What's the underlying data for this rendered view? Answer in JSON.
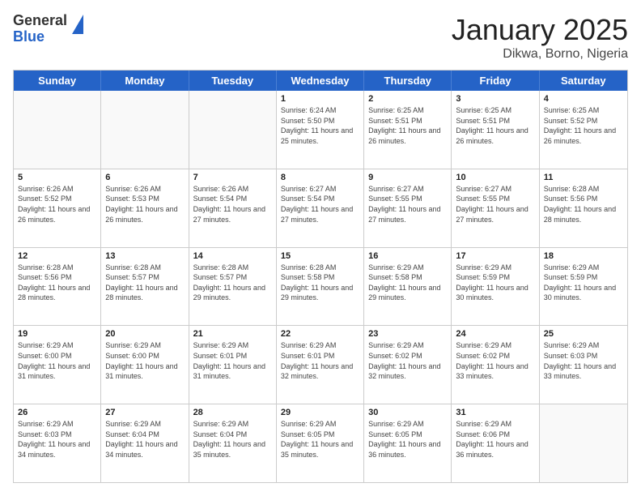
{
  "logo": {
    "general": "General",
    "blue": "Blue"
  },
  "header": {
    "month": "January 2025",
    "location": "Dikwa, Borno, Nigeria"
  },
  "days": {
    "headers": [
      "Sunday",
      "Monday",
      "Tuesday",
      "Wednesday",
      "Thursday",
      "Friday",
      "Saturday"
    ]
  },
  "weeks": [
    [
      {
        "num": "",
        "sunrise": "",
        "sunset": "",
        "daylight": "",
        "empty": true
      },
      {
        "num": "",
        "sunrise": "",
        "sunset": "",
        "daylight": "",
        "empty": true
      },
      {
        "num": "",
        "sunrise": "",
        "sunset": "",
        "daylight": "",
        "empty": true
      },
      {
        "num": "1",
        "sunrise": "Sunrise: 6:24 AM",
        "sunset": "Sunset: 5:50 PM",
        "daylight": "Daylight: 11 hours and 25 minutes.",
        "empty": false
      },
      {
        "num": "2",
        "sunrise": "Sunrise: 6:25 AM",
        "sunset": "Sunset: 5:51 PM",
        "daylight": "Daylight: 11 hours and 26 minutes.",
        "empty": false
      },
      {
        "num": "3",
        "sunrise": "Sunrise: 6:25 AM",
        "sunset": "Sunset: 5:51 PM",
        "daylight": "Daylight: 11 hours and 26 minutes.",
        "empty": false
      },
      {
        "num": "4",
        "sunrise": "Sunrise: 6:25 AM",
        "sunset": "Sunset: 5:52 PM",
        "daylight": "Daylight: 11 hours and 26 minutes.",
        "empty": false
      }
    ],
    [
      {
        "num": "5",
        "sunrise": "Sunrise: 6:26 AM",
        "sunset": "Sunset: 5:52 PM",
        "daylight": "Daylight: 11 hours and 26 minutes.",
        "empty": false
      },
      {
        "num": "6",
        "sunrise": "Sunrise: 6:26 AM",
        "sunset": "Sunset: 5:53 PM",
        "daylight": "Daylight: 11 hours and 26 minutes.",
        "empty": false
      },
      {
        "num": "7",
        "sunrise": "Sunrise: 6:26 AM",
        "sunset": "Sunset: 5:54 PM",
        "daylight": "Daylight: 11 hours and 27 minutes.",
        "empty": false
      },
      {
        "num": "8",
        "sunrise": "Sunrise: 6:27 AM",
        "sunset": "Sunset: 5:54 PM",
        "daylight": "Daylight: 11 hours and 27 minutes.",
        "empty": false
      },
      {
        "num": "9",
        "sunrise": "Sunrise: 6:27 AM",
        "sunset": "Sunset: 5:55 PM",
        "daylight": "Daylight: 11 hours and 27 minutes.",
        "empty": false
      },
      {
        "num": "10",
        "sunrise": "Sunrise: 6:27 AM",
        "sunset": "Sunset: 5:55 PM",
        "daylight": "Daylight: 11 hours and 27 minutes.",
        "empty": false
      },
      {
        "num": "11",
        "sunrise": "Sunrise: 6:28 AM",
        "sunset": "Sunset: 5:56 PM",
        "daylight": "Daylight: 11 hours and 28 minutes.",
        "empty": false
      }
    ],
    [
      {
        "num": "12",
        "sunrise": "Sunrise: 6:28 AM",
        "sunset": "Sunset: 5:56 PM",
        "daylight": "Daylight: 11 hours and 28 minutes.",
        "empty": false
      },
      {
        "num": "13",
        "sunrise": "Sunrise: 6:28 AM",
        "sunset": "Sunset: 5:57 PM",
        "daylight": "Daylight: 11 hours and 28 minutes.",
        "empty": false
      },
      {
        "num": "14",
        "sunrise": "Sunrise: 6:28 AM",
        "sunset": "Sunset: 5:57 PM",
        "daylight": "Daylight: 11 hours and 29 minutes.",
        "empty": false
      },
      {
        "num": "15",
        "sunrise": "Sunrise: 6:28 AM",
        "sunset": "Sunset: 5:58 PM",
        "daylight": "Daylight: 11 hours and 29 minutes.",
        "empty": false
      },
      {
        "num": "16",
        "sunrise": "Sunrise: 6:29 AM",
        "sunset": "Sunset: 5:58 PM",
        "daylight": "Daylight: 11 hours and 29 minutes.",
        "empty": false
      },
      {
        "num": "17",
        "sunrise": "Sunrise: 6:29 AM",
        "sunset": "Sunset: 5:59 PM",
        "daylight": "Daylight: 11 hours and 30 minutes.",
        "empty": false
      },
      {
        "num": "18",
        "sunrise": "Sunrise: 6:29 AM",
        "sunset": "Sunset: 5:59 PM",
        "daylight": "Daylight: 11 hours and 30 minutes.",
        "empty": false
      }
    ],
    [
      {
        "num": "19",
        "sunrise": "Sunrise: 6:29 AM",
        "sunset": "Sunset: 6:00 PM",
        "daylight": "Daylight: 11 hours and 31 minutes.",
        "empty": false
      },
      {
        "num": "20",
        "sunrise": "Sunrise: 6:29 AM",
        "sunset": "Sunset: 6:00 PM",
        "daylight": "Daylight: 11 hours and 31 minutes.",
        "empty": false
      },
      {
        "num": "21",
        "sunrise": "Sunrise: 6:29 AM",
        "sunset": "Sunset: 6:01 PM",
        "daylight": "Daylight: 11 hours and 31 minutes.",
        "empty": false
      },
      {
        "num": "22",
        "sunrise": "Sunrise: 6:29 AM",
        "sunset": "Sunset: 6:01 PM",
        "daylight": "Daylight: 11 hours and 32 minutes.",
        "empty": false
      },
      {
        "num": "23",
        "sunrise": "Sunrise: 6:29 AM",
        "sunset": "Sunset: 6:02 PM",
        "daylight": "Daylight: 11 hours and 32 minutes.",
        "empty": false
      },
      {
        "num": "24",
        "sunrise": "Sunrise: 6:29 AM",
        "sunset": "Sunset: 6:02 PM",
        "daylight": "Daylight: 11 hours and 33 minutes.",
        "empty": false
      },
      {
        "num": "25",
        "sunrise": "Sunrise: 6:29 AM",
        "sunset": "Sunset: 6:03 PM",
        "daylight": "Daylight: 11 hours and 33 minutes.",
        "empty": false
      }
    ],
    [
      {
        "num": "26",
        "sunrise": "Sunrise: 6:29 AM",
        "sunset": "Sunset: 6:03 PM",
        "daylight": "Daylight: 11 hours and 34 minutes.",
        "empty": false
      },
      {
        "num": "27",
        "sunrise": "Sunrise: 6:29 AM",
        "sunset": "Sunset: 6:04 PM",
        "daylight": "Daylight: 11 hours and 34 minutes.",
        "empty": false
      },
      {
        "num": "28",
        "sunrise": "Sunrise: 6:29 AM",
        "sunset": "Sunset: 6:04 PM",
        "daylight": "Daylight: 11 hours and 35 minutes.",
        "empty": false
      },
      {
        "num": "29",
        "sunrise": "Sunrise: 6:29 AM",
        "sunset": "Sunset: 6:05 PM",
        "daylight": "Daylight: 11 hours and 35 minutes.",
        "empty": false
      },
      {
        "num": "30",
        "sunrise": "Sunrise: 6:29 AM",
        "sunset": "Sunset: 6:05 PM",
        "daylight": "Daylight: 11 hours and 36 minutes.",
        "empty": false
      },
      {
        "num": "31",
        "sunrise": "Sunrise: 6:29 AM",
        "sunset": "Sunset: 6:06 PM",
        "daylight": "Daylight: 11 hours and 36 minutes.",
        "empty": false
      },
      {
        "num": "",
        "sunrise": "",
        "sunset": "",
        "daylight": "",
        "empty": true
      }
    ]
  ]
}
